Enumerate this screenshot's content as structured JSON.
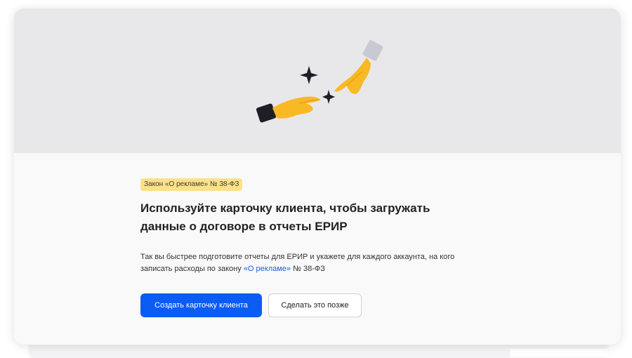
{
  "modal": {
    "illustration_icon": "hands-reaching-sparkles-icon",
    "badge": "Закон «О рекламе» № 38-ФЗ",
    "title": "Используйте карточку клиента, чтобы загружать данные о договоре в отчеты ЕРИР",
    "description_prefix": "Так вы быстрее подготовите отчеты для ЕРИР и укажете для каждого аккаунта, на кого записать расходы по закону ",
    "description_link": "«О рекламе»",
    "description_suffix": " № 38-ФЗ",
    "primary_button": "Создать карточку клиента",
    "secondary_button": "Сделать это позже"
  },
  "colors": {
    "accent": "#0a5cf5",
    "badge_bg": "#fbe18a",
    "link": "#1a5ee0",
    "hero_bg": "#e8e8ea"
  }
}
